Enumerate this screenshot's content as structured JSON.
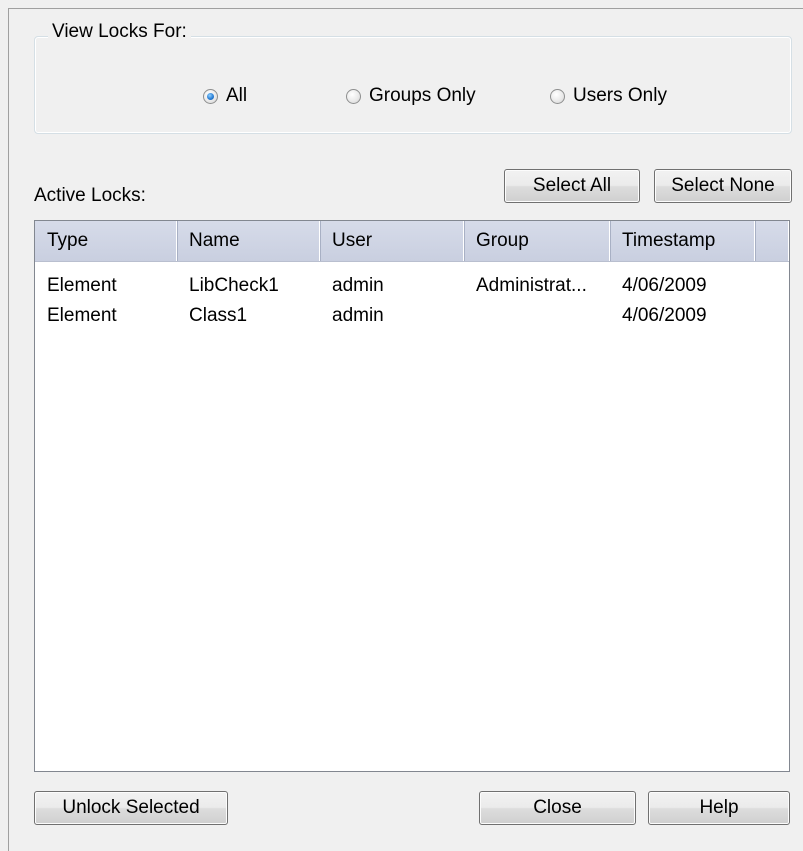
{
  "view_locks": {
    "legend": "View Locks For:",
    "options": [
      {
        "label": "All",
        "checked": true
      },
      {
        "label": "Groups Only",
        "checked": false
      },
      {
        "label": "Users Only",
        "checked": false
      }
    ]
  },
  "active_locks_label": "Active Locks:",
  "buttons": {
    "select_all": "Select All",
    "select_none": "Select None",
    "unlock_selected": "Unlock Selected",
    "close": "Close",
    "help": "Help"
  },
  "table": {
    "columns": [
      "Type",
      "Name",
      "User",
      "Group",
      "Timestamp",
      ""
    ],
    "rows": [
      [
        "Element",
        "LibCheck1",
        "admin",
        "Administrat...",
        "4/06/2009"
      ],
      [
        "Element",
        "Class1",
        "admin",
        "",
        "4/06/2009"
      ]
    ]
  },
  "colors": {
    "header_bg": "#cdd3e3",
    "radio_selected": "#2a7fd6",
    "dialog_bg": "#f0f0f0"
  }
}
